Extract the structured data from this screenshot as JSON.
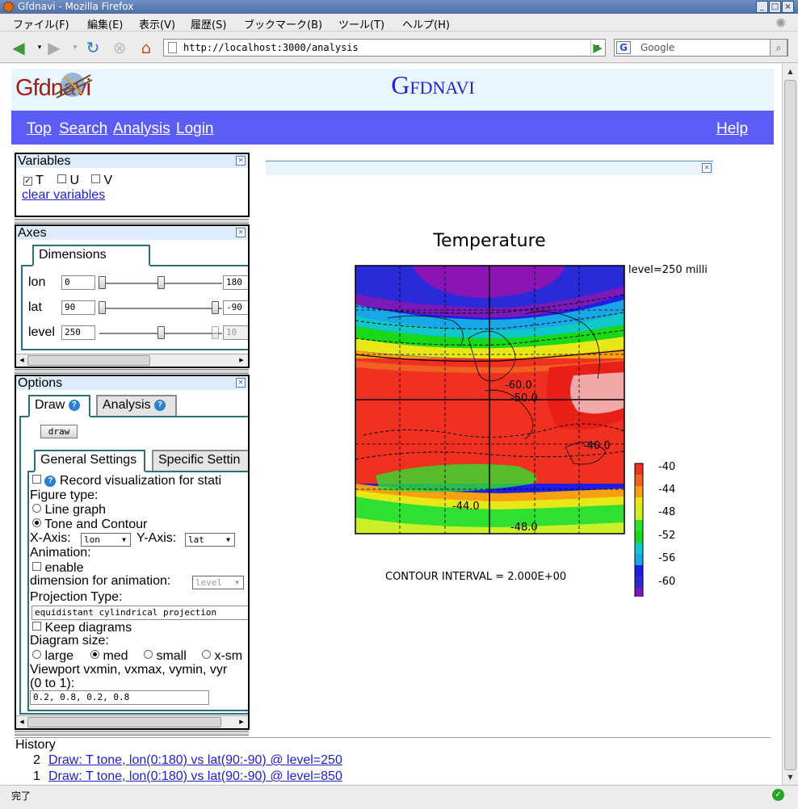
{
  "window": {
    "title": "Gfdnavi - Mozilla Firefox"
  },
  "menu": [
    "ファイル(F)",
    "編集(E)",
    "表示(V)",
    "履歴(S)",
    "ブックマーク(B)",
    "ツール(T)",
    "ヘルプ(H)"
  ],
  "browser": {
    "url": "http://localhost:3000/analysis",
    "search_placeholder": "Google",
    "search_engine_letter": "G",
    "status": "完了"
  },
  "site": {
    "logo": "Gfdnavi",
    "title": "Gfdnavi",
    "nav": [
      "Top",
      "Search",
      "Analysis",
      "Login"
    ],
    "help": "Help"
  },
  "variables_panel": {
    "title": "Variables",
    "items": [
      {
        "label": "T",
        "checked": true
      },
      {
        "label": "U",
        "checked": false
      },
      {
        "label": "V",
        "checked": false
      }
    ],
    "clear": "clear variables"
  },
  "axes_panel": {
    "title": "Axes",
    "tab": "Dimensions",
    "rows": [
      {
        "name": "lon",
        "min": "0",
        "max": "180"
      },
      {
        "name": "lat",
        "min": "90",
        "max": "-90"
      },
      {
        "name": "level",
        "min": "250",
        "max": "10"
      }
    ]
  },
  "options_panel": {
    "title": "Options",
    "tabs": [
      "Draw",
      "Analysis"
    ],
    "draw_button": "draw",
    "subtabs": [
      "General Settings",
      "Specific Settin"
    ],
    "record": "Record visualization for stati",
    "figure_type_label": "Figure type:",
    "figure_types": [
      {
        "label": "Line graph",
        "selected": false
      },
      {
        "label": "Tone and Contour",
        "selected": true
      }
    ],
    "xaxis_label": "X-Axis:",
    "xaxis_value": "lon",
    "yaxis_label": "Y-Axis:",
    "yaxis_value": "lat",
    "animation_label": "Animation:",
    "enable_label": "enable",
    "dim_anim_label": "dimension for animation:",
    "dim_anim_value": "level",
    "projection_label": "Projection Type:",
    "projection_value": "equidistant cylindrical projection",
    "keep_label": "Keep diagrams",
    "size_label": "Diagram size:",
    "sizes": [
      {
        "label": "large",
        "selected": false
      },
      {
        "label": "med",
        "selected": true
      },
      {
        "label": "small",
        "selected": false
      },
      {
        "label": "x-sm",
        "selected": false
      }
    ],
    "viewport_label": "Viewport vxmin, vxmax, vymin, vyr",
    "viewport_label2": "(0 to 1):",
    "viewport_value": "0.2, 0.8, 0.2, 0.8"
  },
  "figure": {
    "title": "Temperature",
    "level_note": "level=250 milli",
    "contour_labels": [
      "-60.0",
      "-50.0",
      "-40.0",
      "-44.0",
      "-48.0"
    ],
    "colorbar_ticks": [
      "-40",
      "-44",
      "-48",
      "-52",
      "-56",
      "-60"
    ],
    "interval": "CONTOUR INTERVAL = 2.000E+00"
  },
  "history": {
    "title": "History",
    "items": [
      {
        "num": "2",
        "text": "Draw: T tone, lon(0:180) vs lat(90:-90) @ level=250"
      },
      {
        "num": "1",
        "text": "Draw: T tone, lon(0:180) vs lat(90:-90) @ level=850"
      }
    ]
  },
  "colors": {
    "accent_nav": "#5c5cf6",
    "header_bg": "#e8f6fd",
    "link": "#2020c8"
  }
}
